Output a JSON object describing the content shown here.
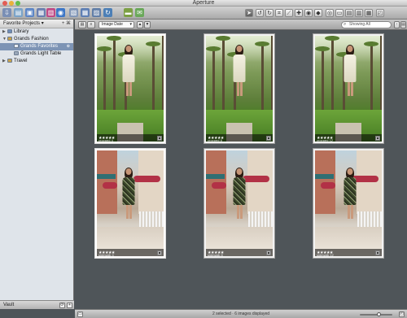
{
  "window": {
    "title": "Aperture"
  },
  "toolbar": {
    "left_icons": [
      {
        "name": "new-project-icon",
        "glyph": "⇩",
        "color": "#7a8fb5"
      },
      {
        "name": "new-folder-icon",
        "glyph": "▤",
        "color": "#7aa3c8"
      },
      {
        "name": "new-album-icon",
        "glyph": "▣",
        "color": "#5d86c6"
      },
      {
        "name": "new-light-table-icon",
        "glyph": "▦",
        "color": "#6a7fb0"
      },
      {
        "name": "new-book-icon",
        "glyph": "▥",
        "color": "#c04a86"
      },
      {
        "name": "new-web-page-icon",
        "glyph": "◉",
        "color": "#3d77c7"
      },
      {
        "name": "new-smart-album-icon",
        "glyph": "▧",
        "color": "#8297b8"
      },
      {
        "name": "stack-icon",
        "glyph": "▦",
        "color": "#5e7fb4"
      },
      {
        "name": "unstack-icon",
        "glyph": "▨",
        "color": "#627fa8"
      },
      {
        "name": "rotate-icon",
        "glyph": "↻",
        "color": "#4c7fb6"
      },
      {
        "name": "import-icon",
        "glyph": "▬",
        "color": "#7ca044"
      },
      {
        "name": "email-icon",
        "glyph": "✉",
        "color": "#6aa85a"
      }
    ],
    "tools": [
      {
        "name": "select-tool-icon",
        "glyph": "➤",
        "active": true
      },
      {
        "name": "rotate-left-tool-icon",
        "glyph": "↺",
        "active": false
      },
      {
        "name": "rotate-right-tool-icon",
        "glyph": "↻",
        "active": false
      },
      {
        "name": "crop-tool-icon",
        "glyph": "⌗",
        "active": false
      },
      {
        "name": "straighten-tool-icon",
        "glyph": "⟋",
        "active": false
      },
      {
        "name": "spot-patch-tool-icon",
        "glyph": "✚",
        "active": false
      },
      {
        "name": "red-eye-tool-icon",
        "glyph": "◉",
        "active": false
      },
      {
        "name": "lift-stamp-tool-icon",
        "glyph": "◆",
        "active": false
      },
      {
        "name": "loupe-icon",
        "glyph": "◎",
        "active": false
      },
      {
        "name": "viewer-mode-icon",
        "glyph": "▭",
        "active": false
      },
      {
        "name": "single-view-icon",
        "glyph": "▤",
        "active": false
      },
      {
        "name": "multi-view-icon",
        "glyph": "▥",
        "active": false
      },
      {
        "name": "split-view-icon",
        "glyph": "▦",
        "active": false
      },
      {
        "name": "full-screen-icon",
        "glyph": "◰",
        "active": false
      }
    ]
  },
  "sidebar": {
    "header": "Favorite Projects",
    "header_actions": "+ ⌘",
    "items": [
      {
        "label": "Library",
        "indent": 0,
        "tri": "▶",
        "icon_color": "#6f8db7",
        "selected": false,
        "badge": ""
      },
      {
        "label": "Grands Fashion",
        "indent": 0,
        "tri": "▼",
        "icon_color": "#c9a34b",
        "selected": false,
        "badge": ""
      },
      {
        "label": "Grands Favorites",
        "indent": 1,
        "tri": "",
        "icon_color": "#e9edf3",
        "selected": true,
        "badge": "⊕"
      },
      {
        "label": "Grands Light Table",
        "indent": 1,
        "tri": "",
        "icon_color": "#9aa7b8",
        "selected": false,
        "badge": ""
      },
      {
        "label": "Travel",
        "indent": 0,
        "tri": "▶",
        "icon_color": "#c9a34b",
        "selected": false,
        "badge": ""
      }
    ],
    "footer_label": "Vault",
    "footer_buttons": [
      "⟳",
      "+"
    ]
  },
  "browser": {
    "view_buttons": [
      "▤",
      "≡"
    ],
    "sort_label": "Image Date",
    "sort_dir_buttons": [
      "▲",
      "▼"
    ],
    "search_placeholder": "Showing All",
    "right_buttons": [
      "↑",
      "▤"
    ]
  },
  "thumbnails": [
    {
      "name": "cropped 4",
      "rating": "★★★★★",
      "scene": "garden",
      "dress": "white",
      "selected": true
    },
    {
      "name": "cropped 8",
      "rating": "★★★★★",
      "scene": "garden",
      "dress": "white",
      "selected": false
    },
    {
      "name": "cropped 12",
      "rating": "★★★★★",
      "scene": "garden",
      "dress": "white",
      "selected": false
    },
    {
      "name": "sidewalk 4",
      "rating": "★★★★★",
      "scene": "street",
      "dress": "print",
      "selected": true
    },
    {
      "name": "sidewalk 8",
      "rating": "★★★★★",
      "scene": "street",
      "dress": "print",
      "selected": false
    },
    {
      "name": "sidewalk 12",
      "rating": "★★★★★",
      "scene": "street",
      "dress": "print",
      "selected": false
    }
  ],
  "status": {
    "text": "2 selected · 6 images displayed",
    "zoom_fraction": 0.6,
    "corner_left": "▭",
    "corner_right": "◰"
  }
}
